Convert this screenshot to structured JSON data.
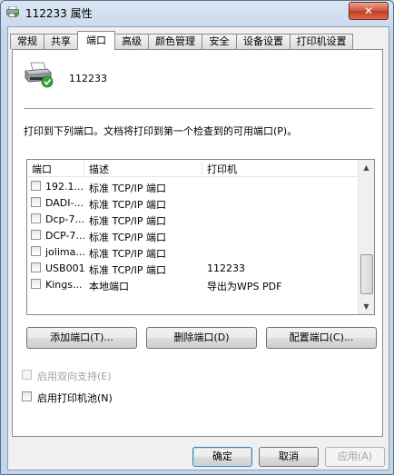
{
  "window": {
    "title": "112233 属性",
    "close_label": "✕"
  },
  "tabs": [
    {
      "label": "常规"
    },
    {
      "label": "共享"
    },
    {
      "label": "端口"
    },
    {
      "label": "高级"
    },
    {
      "label": "颜色管理"
    },
    {
      "label": "安全"
    },
    {
      "label": "设备设置"
    },
    {
      "label": "打印机设置"
    }
  ],
  "active_tab": "端口",
  "printer": {
    "name": "112233"
  },
  "description": "打印到下列端口。文档将打印到第一个检查到的可用端口(P)。",
  "ports": {
    "columns": [
      "端口",
      "描述",
      "打印机"
    ],
    "rows": [
      {
        "port": "192.1...",
        "desc": "标准 TCP/IP 端口",
        "printer": "",
        "checked": false
      },
      {
        "port": "DADI-...",
        "desc": "标准 TCP/IP 端口",
        "printer": "",
        "checked": false
      },
      {
        "port": "Dcp-7...",
        "desc": "标准 TCP/IP 端口",
        "printer": "",
        "checked": false
      },
      {
        "port": "DCP-7...",
        "desc": "标准 TCP/IP 端口",
        "printer": "",
        "checked": false
      },
      {
        "port": "jolima...",
        "desc": "标准 TCP/IP 端口",
        "printer": "",
        "checked": false
      },
      {
        "port": "USB001",
        "desc": "标准 TCP/IP 端口",
        "printer": "112233",
        "checked": false
      },
      {
        "port": "Kings...",
        "desc": "本地端口",
        "printer": "导出为WPS PDF",
        "checked": false
      }
    ]
  },
  "port_buttons": {
    "add": "添加端口(T)...",
    "delete": "删除端口(D)",
    "configure": "配置端口(C)..."
  },
  "options": {
    "bidirectional": {
      "label": "启用双向支持(E)",
      "checked": false,
      "enabled": false
    },
    "pooling": {
      "label": "启用打印机池(N)",
      "checked": false,
      "enabled": true
    }
  },
  "dialog_buttons": {
    "ok": "确定",
    "cancel": "取消",
    "apply": "应用(A)"
  },
  "colors": {
    "title_gradient": "#c4d5ea",
    "close_red": "#c03c24",
    "accent_green": "#3aa33a"
  }
}
